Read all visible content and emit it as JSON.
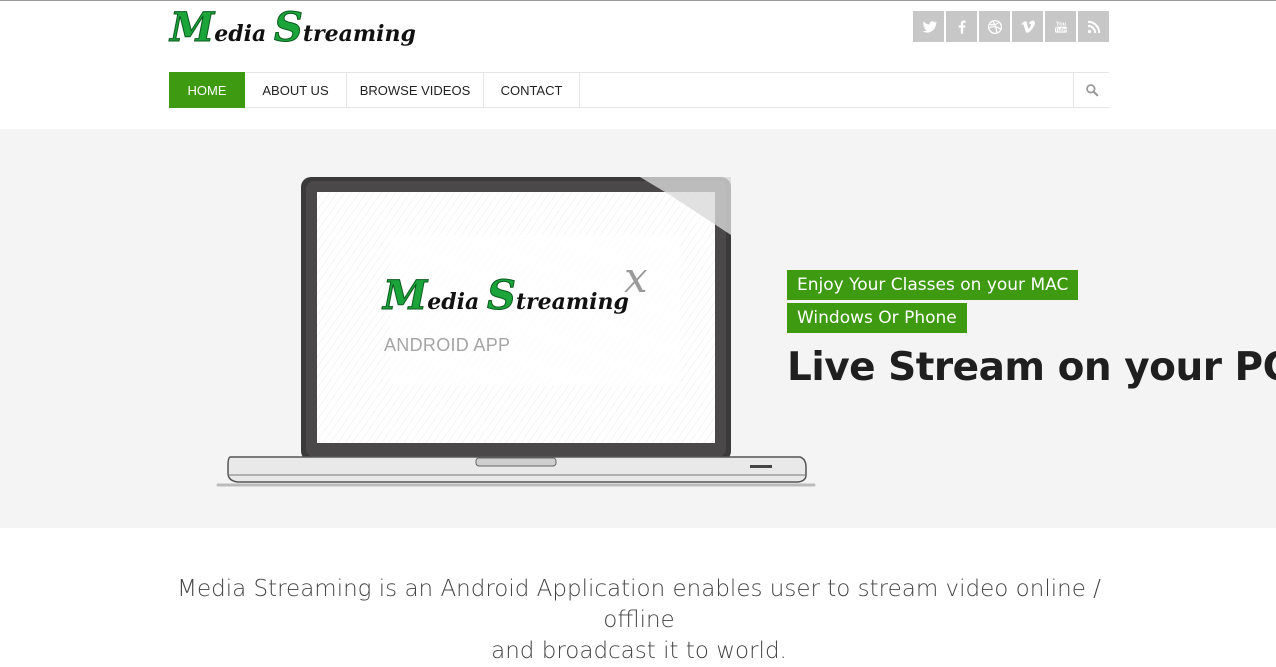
{
  "brand": {
    "logo_letter1": "M",
    "logo_rest1": "edia ",
    "logo_letter2": "S",
    "logo_rest2": "treaming"
  },
  "social": [
    "twitter-icon",
    "facebook-icon",
    "dribbble-icon",
    "vimeo-icon",
    "youtube-icon",
    "rss-icon"
  ],
  "nav": {
    "items": [
      {
        "label": "HOME",
        "active": true
      },
      {
        "label": "ABOUT US"
      },
      {
        "label": "BROWSE VIDEOS"
      },
      {
        "label": "CONTACT"
      }
    ],
    "search_icon": "search-icon"
  },
  "hero": {
    "screen_logo": {
      "letter1": "M",
      "rest1": "edia ",
      "letter2": "S",
      "rest2": "treaming",
      "mark": "x"
    },
    "screen_subtitle": "ANDROID APP",
    "taglines": [
      "Enjoy Your Classes on your MAC",
      "Windows Or Phone"
    ],
    "title": "Live Stream on your PC"
  },
  "description": {
    "line1": "Media Streaming is an Android Application enables user to stream video online / offline",
    "line2": "and broadcast it to world."
  },
  "colors": {
    "accent": "#3e9a10",
    "logo_green": "#1aa43a",
    "hero_bg": "#f4f4f4",
    "social_bg": "#c7c7c7"
  }
}
